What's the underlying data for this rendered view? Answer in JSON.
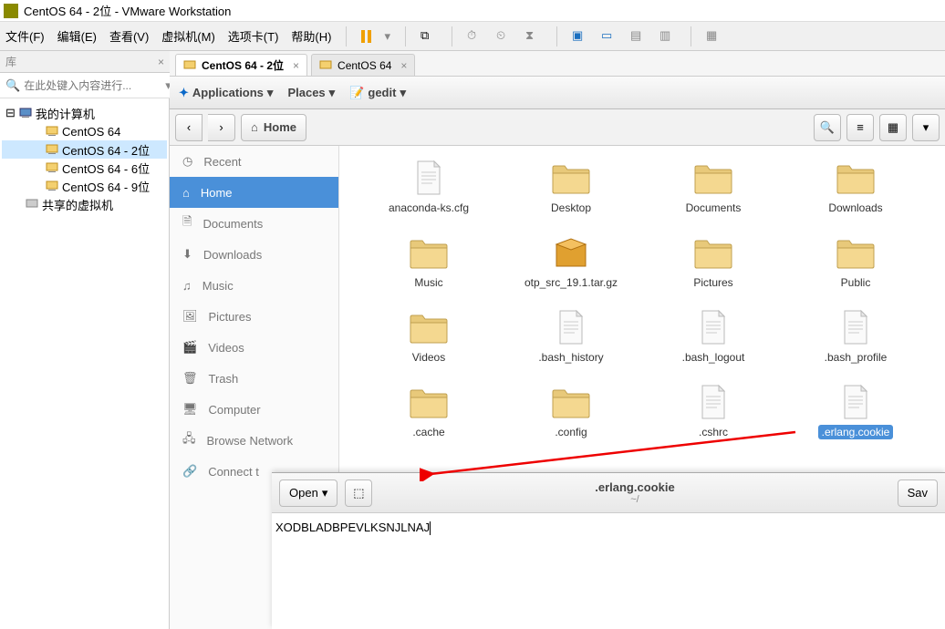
{
  "window": {
    "title": "CentOS 64 - 2位 - VMware Workstation"
  },
  "menu": [
    "文件(F)",
    "编辑(E)",
    "查看(V)",
    "虚拟机(M)",
    "选项卡(T)",
    "帮助(H)"
  ],
  "library": {
    "header": "库",
    "search_placeholder": "在此处键入内容进行..."
  },
  "tree": {
    "root": "我的计算机",
    "vms": [
      "CentOS 64",
      "CentOS 64 - 2位",
      "CentOS 64 - 6位",
      "CentOS 64 - 9位"
    ],
    "shared": "共享的虚拟机",
    "selected": "CentOS 64 - 2位"
  },
  "tabs": [
    {
      "label": "CentOS 64 - 2位",
      "active": true
    },
    {
      "label": "CentOS 64",
      "active": false
    }
  ],
  "gnome": {
    "apps": "Applications",
    "places": "Places",
    "gedit": "gedit"
  },
  "nav": {
    "home": "Home"
  },
  "places": [
    {
      "name": "Recent",
      "icon": "clock"
    },
    {
      "name": "Home",
      "icon": "home",
      "active": true
    },
    {
      "name": "Documents",
      "icon": "doc"
    },
    {
      "name": "Downloads",
      "icon": "down"
    },
    {
      "name": "Music",
      "icon": "music"
    },
    {
      "name": "Pictures",
      "icon": "pic"
    },
    {
      "name": "Videos",
      "icon": "video"
    },
    {
      "name": "Trash",
      "icon": "trash"
    },
    {
      "name": "Computer",
      "icon": "computer"
    },
    {
      "name": "Browse Network",
      "icon": "network"
    },
    {
      "name": "Connect t",
      "icon": "connect"
    }
  ],
  "files": [
    {
      "name": "anaconda-ks.cfg",
      "type": "file"
    },
    {
      "name": "Desktop",
      "type": "folder",
      "emblem": "desktop"
    },
    {
      "name": "Documents",
      "type": "folder",
      "emblem": "doc"
    },
    {
      "name": "Downloads",
      "type": "folder",
      "emblem": "down"
    },
    {
      "name": "Music",
      "type": "folder",
      "emblem": "music"
    },
    {
      "name": "otp_src_19.1.tar.gz",
      "type": "package"
    },
    {
      "name": "Pictures",
      "type": "folder",
      "emblem": "pic"
    },
    {
      "name": "Public",
      "type": "folder",
      "emblem": "public"
    },
    {
      "name": "Videos",
      "type": "folder",
      "emblem": "video"
    },
    {
      "name": ".bash_history",
      "type": "file"
    },
    {
      "name": ".bash_logout",
      "type": "file"
    },
    {
      "name": ".bash_profile",
      "type": "file"
    },
    {
      "name": ".cache",
      "type": "folder"
    },
    {
      "name": ".config",
      "type": "folder"
    },
    {
      "name": ".cshrc",
      "type": "file"
    },
    {
      "name": ".erlang.cookie",
      "type": "file",
      "selected": true
    }
  ],
  "gedit_win": {
    "open": "Open",
    "save": "Sav",
    "title": ".erlang.cookie",
    "subtitle": "~/",
    "content": "XODBLADBPEVLKSNJLNAJ"
  }
}
